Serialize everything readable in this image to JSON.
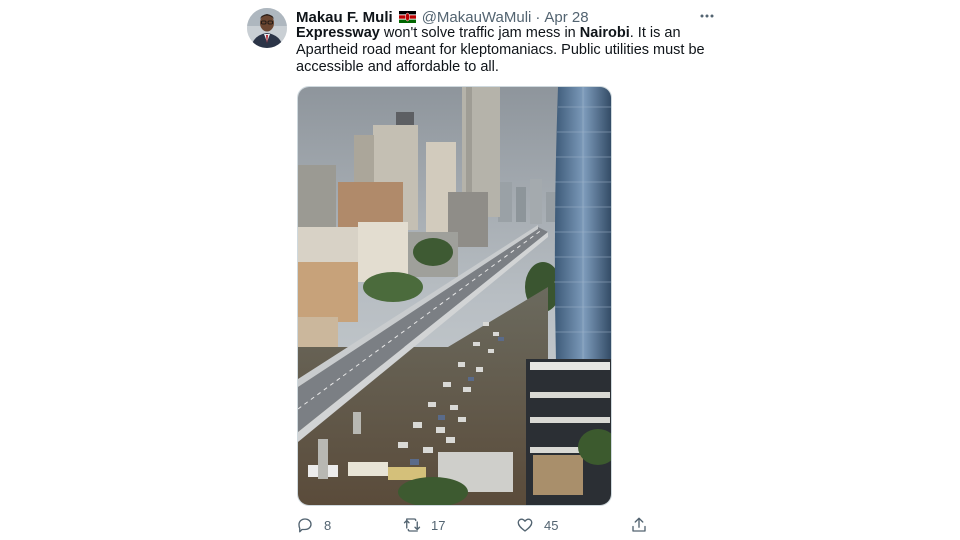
{
  "tweet": {
    "author_name": "Makau F. Muli",
    "handle": "@MakauWaMuli",
    "separator": "·",
    "date": "Apr 28",
    "text_parts": [
      {
        "bold": true,
        "text": "Expressway"
      },
      {
        "bold": false,
        "text": " won't solve traffic jam mess in "
      },
      {
        "bold": true,
        "text": "Nairobi"
      },
      {
        "bold": false,
        "text": ". It is an Apartheid road meant for kleptomaniacs. Public utilities must be accessible and affordable to all."
      }
    ]
  },
  "actions": {
    "replies": "8",
    "retweets": "17",
    "likes": "45"
  },
  "icons": {
    "more": "more-horizontal-icon",
    "reply": "reply-icon",
    "retweet": "retweet-icon",
    "like": "heart-icon",
    "share": "share-icon",
    "flag": "kenya-flag-icon"
  },
  "colors": {
    "text": "#0f1419",
    "secondary": "#536471",
    "border": "#cfd9de"
  }
}
